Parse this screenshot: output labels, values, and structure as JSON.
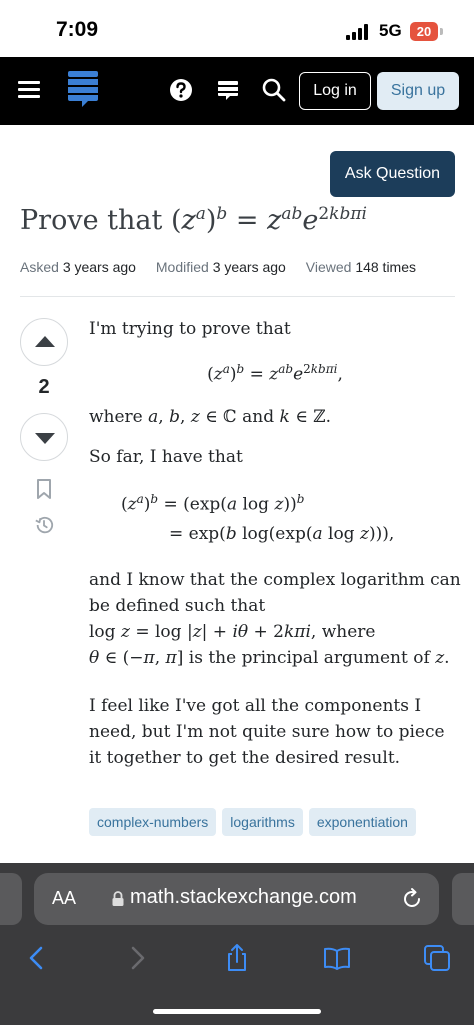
{
  "status": {
    "time": "7:09",
    "network": "5G",
    "battery": "20"
  },
  "header": {
    "login_label": "Log in",
    "signup_label": "Sign up"
  },
  "ask_button": "Ask Question",
  "question": {
    "title_prefix": "Prove that",
    "meta": {
      "asked_label": "Asked",
      "asked_value": "3 years ago",
      "modified_label": "Modified",
      "modified_value": "3 years ago",
      "viewed_label": "Viewed",
      "viewed_value": "148 times"
    },
    "votes": "2",
    "body": {
      "p1": "I'm trying to prove that",
      "p2_where": "where",
      "p2_and": "and",
      "p3": "So far, I have that",
      "p4_a": "and I know that the complex logarithm can be defined such that",
      "p4_where": "where",
      "p4_is": "is the principal argument of",
      "p5": "I feel like I've got all the components I need, but I'm not quite sure how to piece it together to get the desired result."
    },
    "tags": [
      "complex-numbers",
      "logarithms",
      "exponentiation"
    ]
  },
  "browser": {
    "aa_label": "AA",
    "url": "math.stackexchange.com"
  }
}
